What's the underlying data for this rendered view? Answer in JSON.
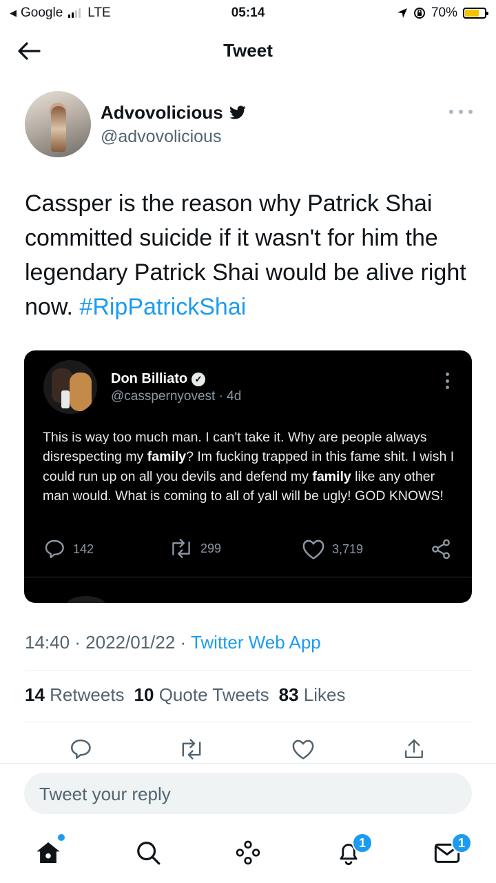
{
  "status_bar": {
    "back_app": "Google",
    "network": "LTE",
    "time": "05:14",
    "battery": "70%",
    "battery_level": 0.7
  },
  "header": {
    "title": "Tweet",
    "back_icon": "back-arrow-icon"
  },
  "tweet": {
    "author_name": "Advovolicious",
    "author_handle": "@advovolicious",
    "text": "Cassper is the reason why Patrick Shai committed suicide if it wasn't for him the legendary Patrick Shai would be alive right now.",
    "hashtag": "#RipPatrickShai",
    "timestamp": "14:40 · 2022/01/22 · ",
    "source": "Twitter Web App",
    "stats": {
      "retweets_count": "14",
      "retweets_label": "Retweets",
      "quotes_count": "10",
      "quotes_label": "Quote Tweets",
      "likes_count": "83",
      "likes_label": "Likes"
    }
  },
  "embedded_tweet": {
    "author_name": "Don Billiato",
    "handle_time": "@casspernyovest · 4d",
    "text_parts": {
      "p1": "This is way too much man. I can't take it. Why are people always disrespecting my ",
      "b1": "family",
      "p2": "? Im fucking trapped in this fame shit. I wish I could run up on all you devils and defend my ",
      "b2": "family",
      "p3": " like any other man would. What is coming to all of yall will be ugly! GOD KNOWS!"
    },
    "replies": "142",
    "retweets": "299",
    "likes": "3,719"
  },
  "reply": {
    "placeholder": "Tweet your reply"
  },
  "bottom_nav": {
    "notifications_badge": "1",
    "messages_badge": "1"
  },
  "colors": {
    "accent": "#1d9bf0",
    "text_secondary": "#536471",
    "battery": "#f5c400"
  }
}
